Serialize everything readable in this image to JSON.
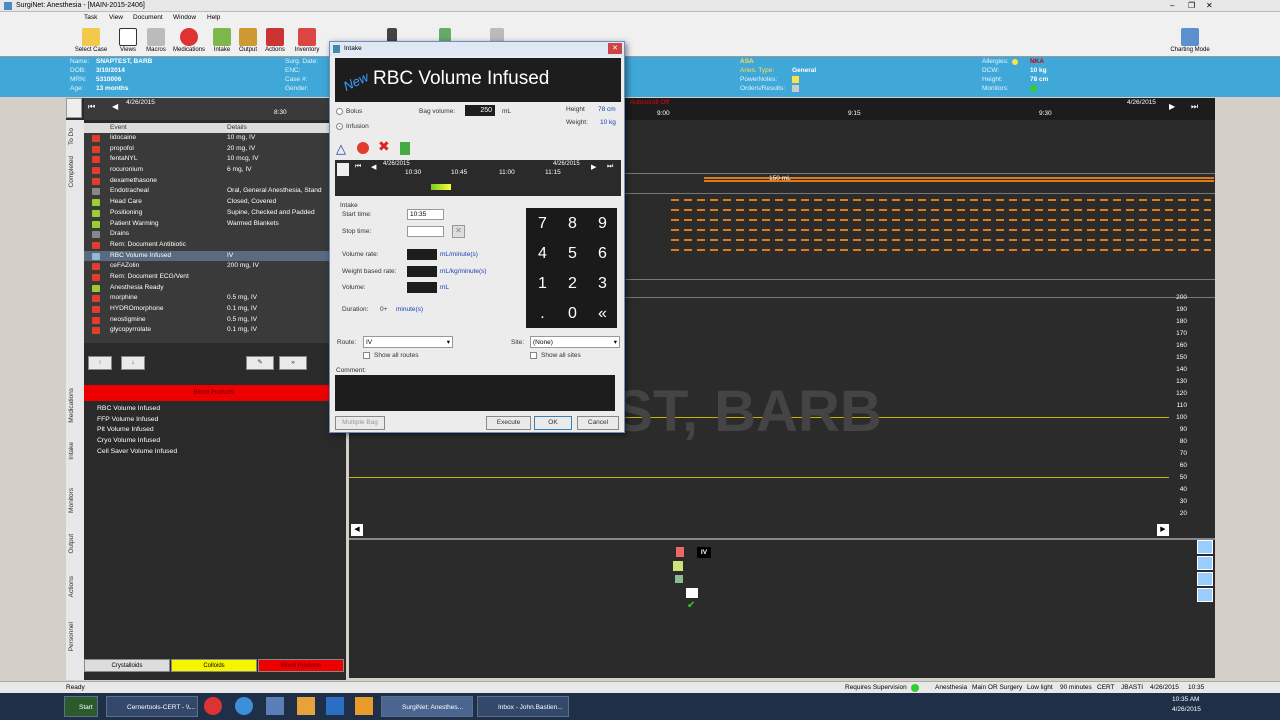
{
  "window": {
    "title": "SurgiNet: Anesthesia - [MAIN-2015-2406]"
  },
  "menu": [
    "Task",
    "View",
    "Document",
    "Window",
    "Help"
  ],
  "toolbar": {
    "buttons": [
      "Select Case",
      "Views",
      "Macros",
      "Medications",
      "Intake",
      "Output",
      "Actions",
      "Inventory"
    ],
    "charting_mode": "Charting Mode"
  },
  "patient": {
    "name_label": "Name:",
    "name": "SNAPTEST, BARB",
    "dob_label": "DOB:",
    "dob": "3/10/2014",
    "mrn_label": "MRN:",
    "mrn": "5310006",
    "age_label": "Age:",
    "age": "13 months",
    "surg_date_label": "Surg. Date:",
    "enc_label": "ENC:",
    "case_label": "Case #:",
    "height_label": "Height:",
    "gender_label": "Gender:",
    "asa_label": "ASA",
    "anes_type_label": "Anes. Type:",
    "anes_type": "General",
    "powernotes_label": "PowerNotes:",
    "orders_label": "Orders/Results:",
    "allergies_label": "Allergies:",
    "allergies": "NKA",
    "dcw_label": "DCW:",
    "dcw": "10 kg",
    "height2_label": "Height:",
    "height2": "78 cm",
    "monitors_label": "Monitors:"
  },
  "timeline": {
    "date_left": "4/26/2015",
    "date_right": "4/26/2015",
    "t830": "8:30",
    "t900": "9:00",
    "t915": "9:15",
    "t930": "9:30",
    "autoscroll": "Autoscroll Off"
  },
  "sidetabs": {
    "todo": "To Do",
    "completed": "Completed",
    "medications": "Medications",
    "intake": "Intake",
    "monitors": "Monitors",
    "output": "Output",
    "actions": "Actions",
    "personnel": "Personnel"
  },
  "events": {
    "col_event": "Event",
    "col_details": "Details",
    "rows": [
      {
        "name": "lidocaine",
        "details": "10 mg, IV",
        "color": "#e23c2c"
      },
      {
        "name": "propofol",
        "details": "20 mg, IV",
        "color": "#e23c2c"
      },
      {
        "name": "fentaNYL",
        "details": "10 mcg, IV",
        "color": "#e23c2c"
      },
      {
        "name": "rocuronium",
        "details": "6 mg, IV",
        "color": "#e23c2c"
      },
      {
        "name": "dexamethasone",
        "details": "",
        "color": "#e23c2c"
      },
      {
        "name": "Endotracheal",
        "details": "Oral, General Anesthesia, Stand",
        "color": "#888888"
      },
      {
        "name": "Head Care",
        "details": "Closed, Covered",
        "color": "#9acd32"
      },
      {
        "name": "Positioning",
        "details": "Supine, Checked and Padded",
        "color": "#9acd32"
      },
      {
        "name": "Patient Warming",
        "details": "Warmed Blankets",
        "color": "#9acd32"
      },
      {
        "name": "Drains",
        "details": "",
        "color": "#888888"
      },
      {
        "name": "Rem: Document Antibiotic",
        "details": "",
        "color": "#e23c2c"
      },
      {
        "name": "RBC Volume Infused",
        "details": "IV",
        "color": "#8fbcd4"
      },
      {
        "name": "ceFAZolin",
        "details": "200 mg, IV",
        "color": "#e23c2c"
      },
      {
        "name": "Rem: Document ECG/Vent",
        "details": "",
        "color": "#e23c2c"
      },
      {
        "name": "Anesthesia Ready",
        "details": "",
        "color": "#9acd32"
      },
      {
        "name": "morphine",
        "details": "0.5 mg, IV",
        "color": "#e23c2c"
      },
      {
        "name": "HYDROmorphone",
        "details": "0.1 mg, IV",
        "color": "#e23c2c"
      },
      {
        "name": "neostigmine",
        "details": "0.5 mg, IV",
        "color": "#e23c2c"
      },
      {
        "name": "glycopyrrolate",
        "details": "0.1 mg, IV",
        "color": "#e23c2c"
      }
    ]
  },
  "blood": {
    "header": "Blood Products",
    "items": [
      "RBC Volume Infused",
      "FFP Volume Infused",
      "Plt Volume Infused",
      "Cryo Volume Infused",
      "Cell Saver Volume Infused"
    ],
    "tabs": [
      "Crystalloids",
      "Colloids",
      "Blood Products"
    ]
  },
  "chart": {
    "bar_label": "150 mL",
    "watermark": "SNAPTEST, BARB",
    "yticks": [
      "200",
      "190",
      "180",
      "170",
      "160",
      "150",
      "140",
      "130",
      "120",
      "110",
      "100",
      "90",
      "80",
      "70",
      "60",
      "50",
      "40",
      "30",
      "20"
    ],
    "iv_label": "IV"
  },
  "dialog": {
    "title": "Intake",
    "new_badge": "New",
    "heading": "RBC Volume Infused",
    "bolus": "Bolus",
    "infusion": "Infusion",
    "bag_volume_label": "Bag volume:",
    "bag_volume": "250",
    "bag_unit": "mL",
    "height_label": "Height",
    "height_value": "78 cm",
    "weight_label": "Weight:",
    "weight_value": "10 kg",
    "mini_date_left": "4/26/2015",
    "mini_date_right": "4/26/2015",
    "mini_times": [
      "10:30",
      "10:45",
      "11:00",
      "11:15"
    ],
    "section": "Intake",
    "start_time_label": "Start time:",
    "start_time": "10:35",
    "stop_time_label": "Stop time:",
    "volume_rate_label": "Volume rate:",
    "volume_rate_unit": "mL/minute(s)",
    "weight_rate_label": "Weight based rate:",
    "weight_rate_unit": "mL/kg/minute(s)",
    "volume_label": "Volume:",
    "volume_unit": "mL",
    "duration_label": "Duration:",
    "duration_value": "0+",
    "duration_unit": "minute(s)",
    "keys": [
      "7",
      "8",
      "9",
      "4",
      "5",
      "6",
      "1",
      "2",
      "3",
      ".",
      "0",
      "«"
    ],
    "route_label": "Route:",
    "route_value": "IV",
    "show_routes": "Show all routes",
    "site_label": "Site:",
    "site_value": "(None)",
    "show_sites": "Show all sites",
    "comment_label": "Comment:",
    "multiple_bag": "Multiple Bag",
    "execute": "Execute",
    "ok": "OK",
    "cancel": "Cancel"
  },
  "status": {
    "ready": "Ready",
    "requires_supervision": "Requires Supervision",
    "anesthesia": "Anesthesia",
    "room": "Main OR Surgery",
    "light": "Low light",
    "duration": "90 minutes",
    "cert": "CERT",
    "user": "JBASTI",
    "date": "4/26/2015",
    "time": "10:35"
  },
  "taskbar": {
    "start": "Start",
    "items": [
      "Cernertools-CERT - \\\\...",
      "SurgiNet: Anesthes...",
      "Inbox - John.Bastien..."
    ],
    "clock_time": "10:35 AM",
    "clock_date": "4/26/2015"
  }
}
